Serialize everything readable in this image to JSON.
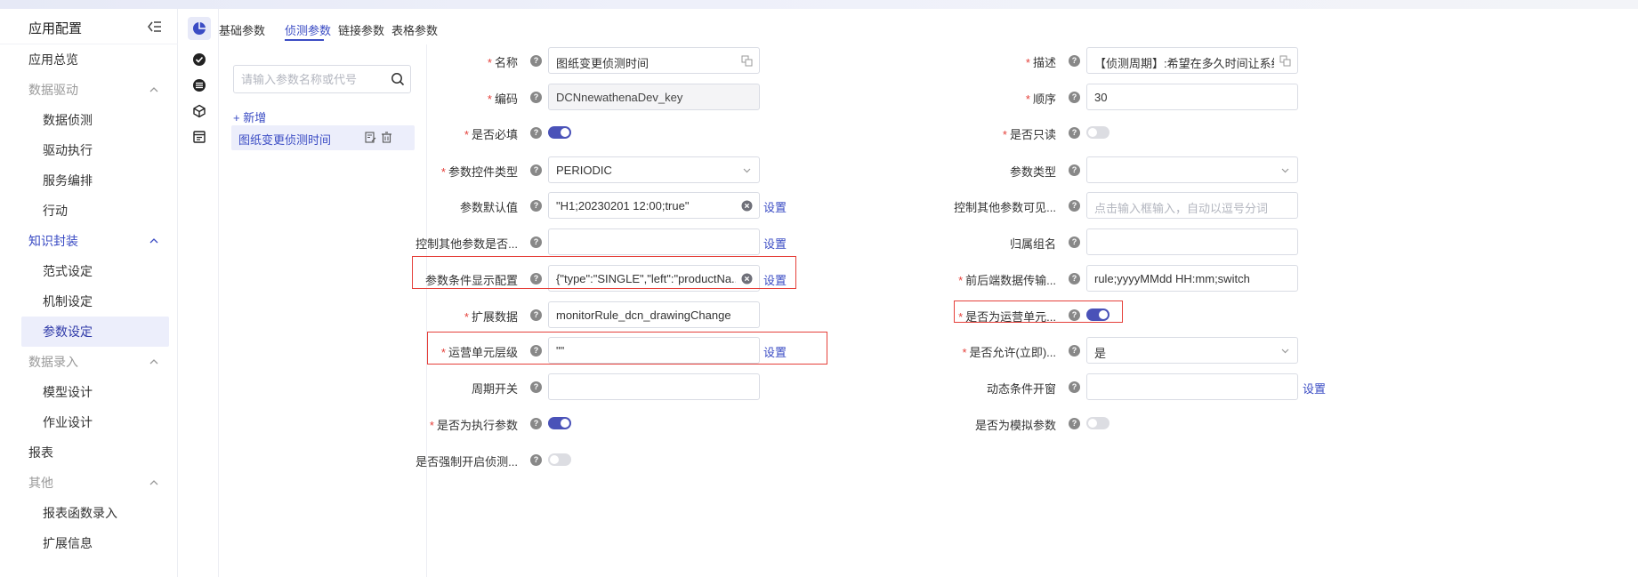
{
  "sidebar": {
    "title": "应用配置",
    "items": [
      {
        "label": "应用总览",
        "kind": "top"
      },
      {
        "label": "数据驱动",
        "kind": "group"
      },
      {
        "label": "数据侦测",
        "kind": "sub"
      },
      {
        "label": "驱动执行",
        "kind": "sub"
      },
      {
        "label": "服务编排",
        "kind": "sub"
      },
      {
        "label": "行动",
        "kind": "sub"
      },
      {
        "label": "知识封装",
        "kind": "group-active"
      },
      {
        "label": "范式设定",
        "kind": "sub"
      },
      {
        "label": "机制设定",
        "kind": "sub"
      },
      {
        "label": "参数设定",
        "kind": "selected"
      },
      {
        "label": "数据录入",
        "kind": "group"
      },
      {
        "label": "模型设计",
        "kind": "sub"
      },
      {
        "label": "作业设计",
        "kind": "sub"
      },
      {
        "label": "报表",
        "kind": "top"
      },
      {
        "label": "其他",
        "kind": "group"
      },
      {
        "label": "报表函数录入",
        "kind": "sub"
      },
      {
        "label": "扩展信息",
        "kind": "sub"
      }
    ]
  },
  "tabs": [
    "基础参数",
    "侦测参数",
    "链接参数",
    "表格参数"
  ],
  "left_panel": {
    "search_placeholder": "请输入参数名称或代号",
    "add_label": "+ 新增",
    "selected_item": "图纸变更侦测时间"
  },
  "form": {
    "set_label": "设置",
    "left": {
      "name": {
        "label": "名称",
        "value": "图纸变更侦测时间"
      },
      "code": {
        "label": "编码",
        "value": "DCNnewathenaDev_key"
      },
      "required": {
        "label": "是否必填",
        "on": true
      },
      "control_type": {
        "label": "参数控件类型",
        "value": "PERIODIC"
      },
      "default_value": {
        "label": "参数默认值",
        "value": "\"H1;20230201 12:00;true\""
      },
      "control_other": {
        "label": "控制其他参数是否...",
        "value": ""
      },
      "condition_display": {
        "label": "参数条件显示配置",
        "value": "{\"type\":\"SINGLE\",\"left\":\"productNa..."
      },
      "ext_data": {
        "label": "扩展数据",
        "value": "monitorRule_dcn_drawingChange"
      },
      "unit_level": {
        "label": "运营单元层级",
        "value": "\"\""
      },
      "period_switch": {
        "label": "周期开关",
        "value": ""
      },
      "is_exec_param": {
        "label": "是否为执行参数",
        "on": true
      },
      "force_open": {
        "label": "是否强制开启侦测...",
        "on": false
      }
    },
    "right": {
      "desc": {
        "label": "描述",
        "value": "【侦测周期】:希望在多久时间让系统侦..."
      },
      "order": {
        "label": "顺序",
        "value": "30"
      },
      "readonly": {
        "label": "是否只读",
        "on": false
      },
      "param_type": {
        "label": "参数类型",
        "value": ""
      },
      "control_visible": {
        "label": "控制其他参数可见...",
        "placeholder": "点击输入框输入，自动以逗号分词"
      },
      "group_name": {
        "label": "归属组名",
        "value": ""
      },
      "fe_be_transfer": {
        "label": "前后端数据传输...",
        "value": "rule;yyyyMMdd HH:mm;switch"
      },
      "is_unit": {
        "label": "是否为运营单元...",
        "on": true
      },
      "allow_now": {
        "label": "是否允许(立即)...",
        "value": "是"
      },
      "dynamic_popup": {
        "label": "动态条件开窗",
        "value": ""
      },
      "is_sim_param": {
        "label": "是否为模拟参数",
        "on": false
      }
    }
  },
  "colors": {
    "accent": "#3b4cc4",
    "required": "#e5403a",
    "highlight": "#e5403a"
  }
}
